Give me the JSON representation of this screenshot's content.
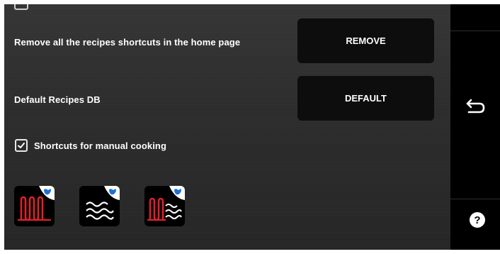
{
  "settings": {
    "remove_row": {
      "label": "Remove all the recipes shortcuts in the home page",
      "button": "REMOVE"
    },
    "default_row": {
      "label": "Default Recipes DB",
      "button": "DEFAULT"
    },
    "manual_shortcuts": {
      "label": "Shortcuts for manual cooking",
      "checked": true
    }
  },
  "shortcut_icons": [
    {
      "icon": "heating-element-icon",
      "accent": "#e0202a"
    },
    {
      "icon": "steam-waves-icon",
      "accent": "#ffffff"
    },
    {
      "icon": "heating-steam-combi-icon",
      "accent": "#e0202a"
    }
  ],
  "sidebar": {
    "back_icon": "back-arrow-icon",
    "help_icon": "help-icon",
    "help_glyph": "?"
  },
  "colors": {
    "badge_hand": "#1e6fd9",
    "button_bg": "#0d0d0d"
  }
}
